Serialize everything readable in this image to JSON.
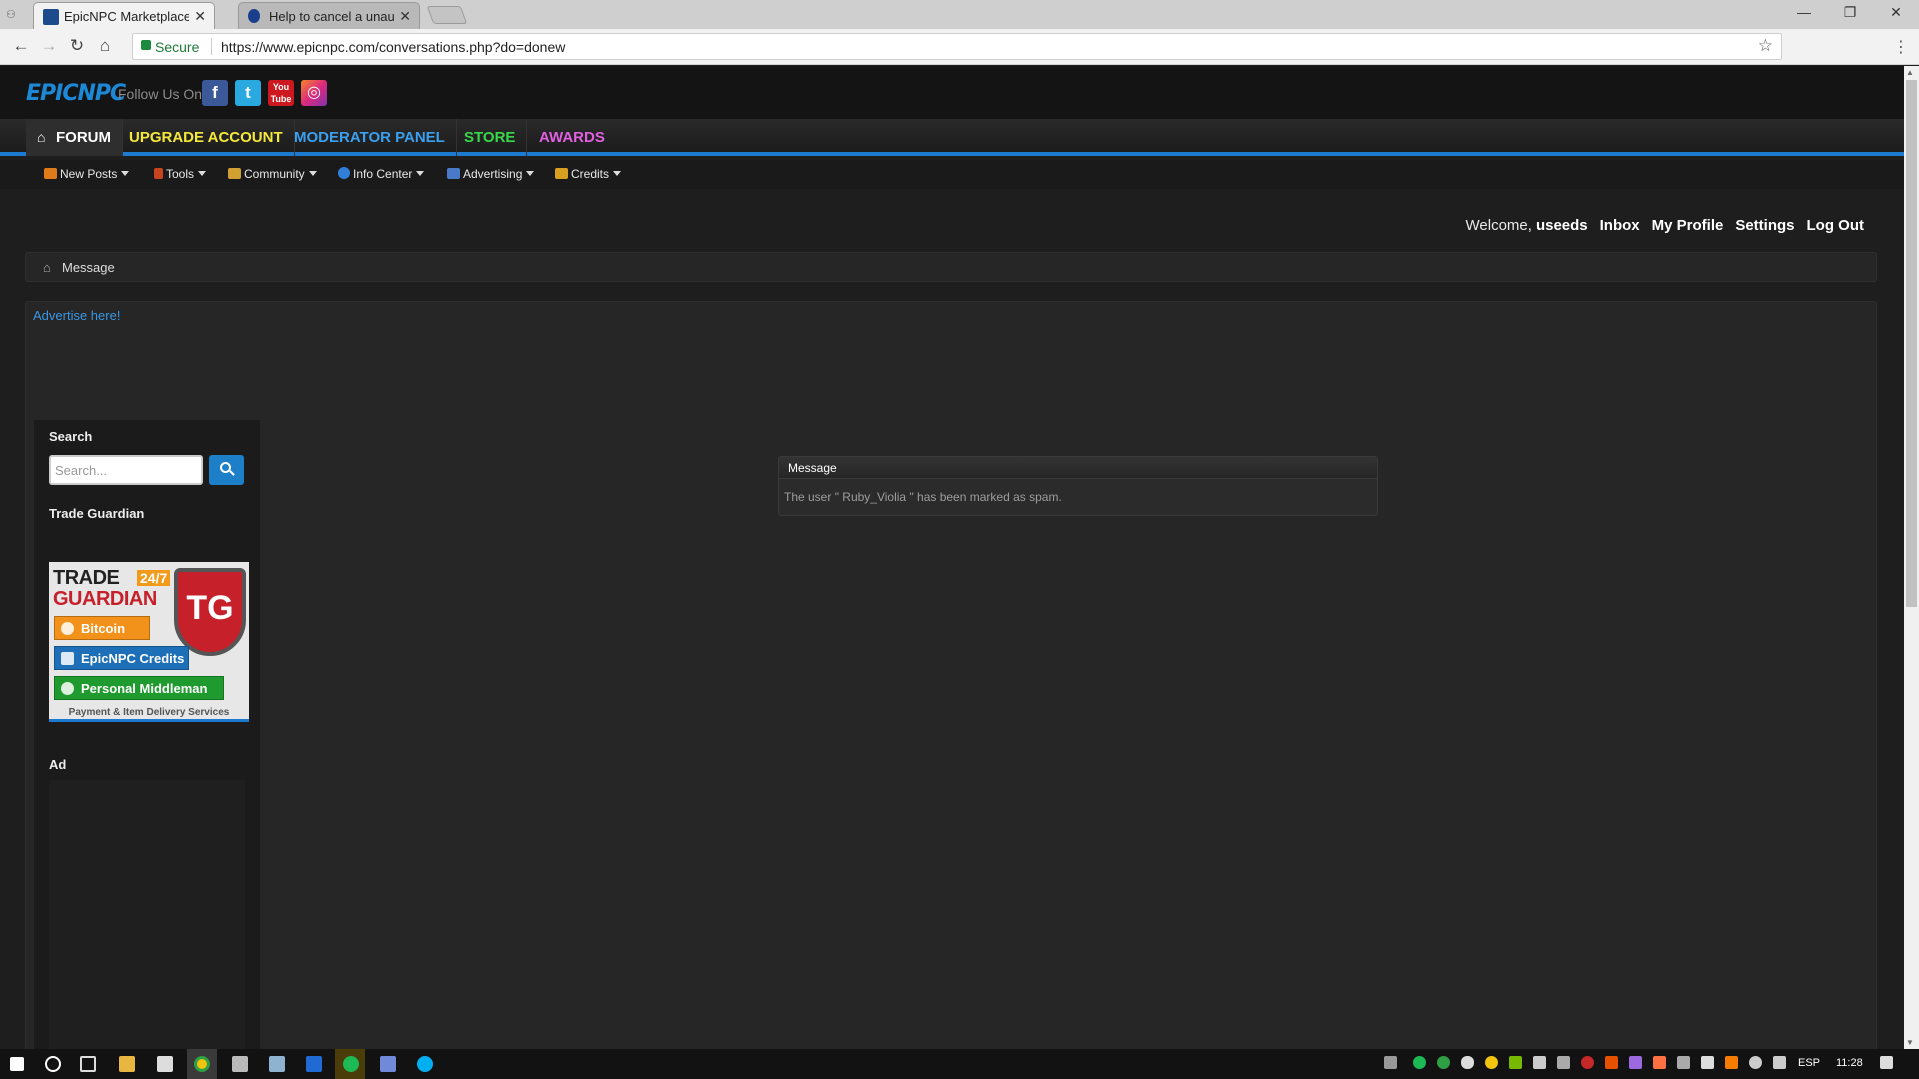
{
  "browser": {
    "tabs": [
      {
        "title": "EpicNPC Marketplace",
        "active": true,
        "favicon_color": "#1c4a8a"
      },
      {
        "title": "Help to cancel a unautho",
        "active": false,
        "favicon_color": "#1a3f8f"
      }
    ],
    "address": {
      "secure_label": "Secure",
      "url": "https://www.epicnpc.com/conversations.php?do=donew"
    }
  },
  "site": {
    "logo_text": "EPICNPC",
    "follow_label": "Follow Us On",
    "social": [
      {
        "name": "facebook",
        "glyph": "f",
        "color": "#3b5998"
      },
      {
        "name": "twitter",
        "glyph": "t",
        "color": "#2aa9e0"
      },
      {
        "name": "youtube",
        "glyph": "You Tube",
        "color": "#cc181e"
      },
      {
        "name": "instagram",
        "glyph": "◎",
        "color": "#c13584"
      }
    ],
    "main_nav": [
      {
        "label": "FORUM",
        "color": "#ffffff"
      },
      {
        "label": "UPGRADE ACCOUNT",
        "color": "#f6e83a"
      },
      {
        "label": "MODERATOR PANEL",
        "color": "#3aa0f0"
      },
      {
        "label": "STORE",
        "color": "#39d84a"
      },
      {
        "label": "AWARDS",
        "color": "#e060e0"
      }
    ],
    "sub_nav": [
      {
        "label": "New Posts",
        "icon_color": "#e07b1a"
      },
      {
        "label": "Tools",
        "icon_color": "#c8431f"
      },
      {
        "label": "Community",
        "icon_color": "#d0a030"
      },
      {
        "label": "Info Center",
        "icon_color": "#2f7fd8"
      },
      {
        "label": "Advertising",
        "icon_color": "#4a79c8"
      },
      {
        "label": "Credits",
        "icon_color": "#d8a020"
      }
    ],
    "welcome": {
      "prefix": "Welcome,",
      "username": "useeds",
      "links": [
        "Inbox",
        "My Profile",
        "Settings",
        "Log Out"
      ]
    },
    "breadcrumb": "Message",
    "advertise_link": "Advertise here!",
    "sidebar": {
      "search_title": "Search",
      "search_placeholder": "Search...",
      "trade_guardian_title": "Trade Guardian",
      "trade_guardian": {
        "line1": "TRADE",
        "badge": "24/7",
        "line2": "GUARDIAN",
        "shield": "TG",
        "options": [
          {
            "label": "Bitcoin",
            "color": "#f2921a"
          },
          {
            "label": "EpicNPC Credits",
            "color": "#1d6fb8"
          },
          {
            "label": "Personal Middleman",
            "color": "#1f9a2e"
          }
        ],
        "footer": "Payment & Item Delivery Services"
      },
      "ad_title": "Ad"
    },
    "message": {
      "title": "Message",
      "body": "The user \" Ruby_Violia \" has been marked as spam."
    }
  },
  "taskbar": {
    "language": "ESP",
    "time": "11:28"
  }
}
